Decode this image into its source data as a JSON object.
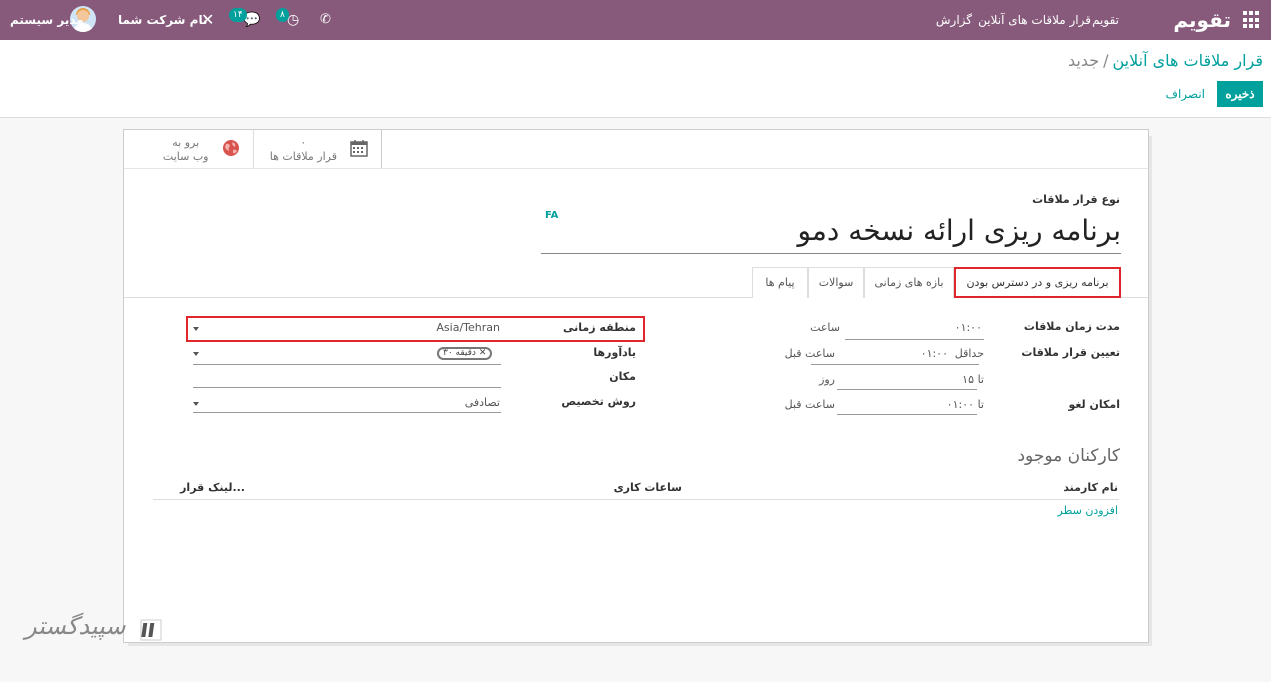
{
  "navbar": {
    "brand": "تقویم",
    "menu": [
      "تقویم",
      "قرار ملاقات های آنلاین",
      "گزارش"
    ],
    "user_name": "مدیر سیستم",
    "company": "نام شرکت شما",
    "chat_badge": "۱۴",
    "activity_badge": "۸",
    "accent_color": "#875a7b"
  },
  "control_panel": {
    "breadcrumb_parent": "قرار ملاقات های آنلاین",
    "breadcrumb_separator": "/",
    "breadcrumb_current": "جدید",
    "save_label": "ذخیره",
    "discard_label": "انصراف"
  },
  "button_box": {
    "meetings_count": "۰",
    "meetings_label": "قرار ملاقات ها",
    "website_label_1": "برو به",
    "website_label_2": "وب سایت"
  },
  "form": {
    "type_label": "نوع قرار ملاقات",
    "lang_tag": "FA",
    "title": "برنامه ریزی ارائه نسخه دمو"
  },
  "tabs": [
    {
      "label": "برنامه ریزی و در دسترس بودن",
      "active": true
    },
    {
      "label": "بازه های زمانی",
      "active": false
    },
    {
      "label": "سوالات",
      "active": false
    },
    {
      "label": "پیام ها",
      "active": false
    }
  ],
  "fields_right": {
    "duration_label": "مدت زمان ملاقات",
    "duration_value": "۰۱:۰۰",
    "duration_unit": "ساعت",
    "scheduling_label": "تعیین قرار ملاقات",
    "min_prefix": "حداقل",
    "min_value": "۰۱:۰۰",
    "min_unit": "ساعت قبل",
    "max_prefix": "تا",
    "max_value": "۱۵",
    "max_unit": "روز",
    "cancel_label": "امکان لغو",
    "cancel_prefix": "تا",
    "cancel_value": "۰۱:۰۰",
    "cancel_unit": "ساعت قبل"
  },
  "fields_left": {
    "timezone_label": "منطقه زمانی",
    "timezone_value": "Asia/Tehran",
    "reminders_label": "یادآورها",
    "reminder_tag": "۳۰ دقیقه",
    "location_label": "مکان",
    "assignment_label": "روش تخصیص",
    "assignment_value": "تصادفی"
  },
  "employees": {
    "section_title": "کارکنان موجود",
    "columns": [
      "نام کارمند",
      "ساعات کاری",
      "لینک قرار..."
    ],
    "add_line": "افزودن سطر"
  },
  "watermark": "سپیدگستر"
}
